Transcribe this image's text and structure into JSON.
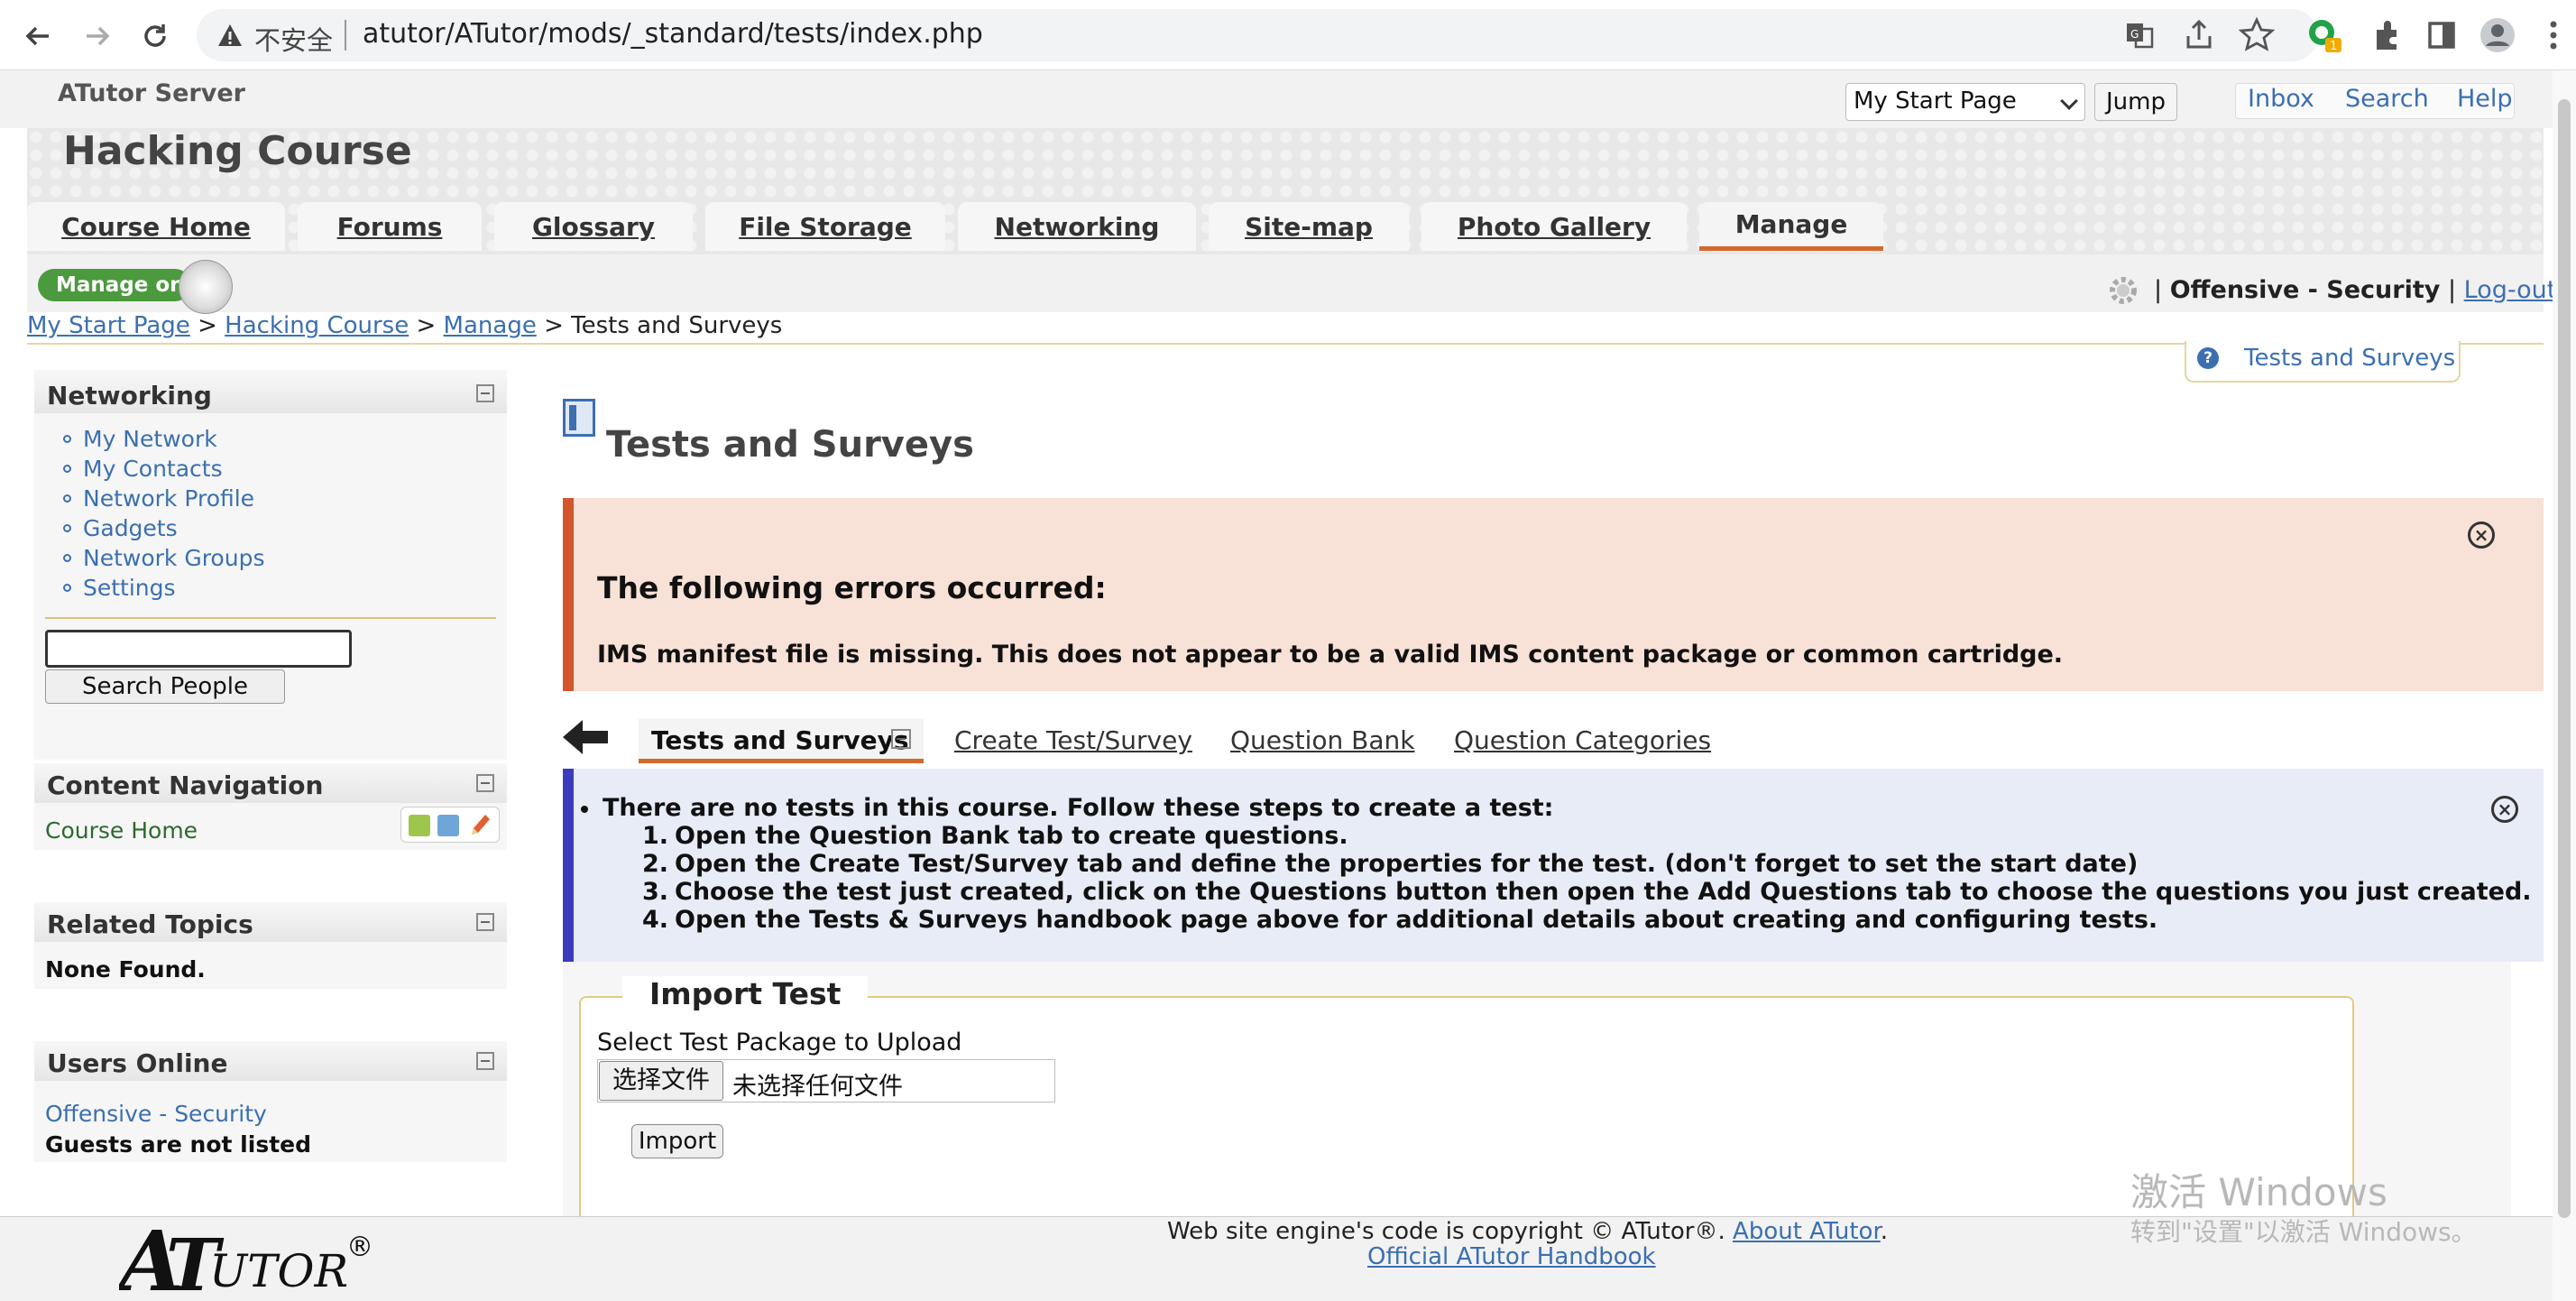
{
  "browser": {
    "insecure_label": "不安全",
    "url": "atutor/ATutor/mods/_standard/tests/index.php"
  },
  "top": {
    "site_name": "ATutor Server",
    "jump_select": "My Start Page",
    "jump_button": "Jump",
    "links": [
      "Inbox",
      "Search",
      "Help"
    ]
  },
  "course": {
    "title": "Hacking Course",
    "tabs": [
      "Course Home",
      "Forums",
      "Glossary",
      "File Storage",
      "Networking",
      "Site-map",
      "Photo Gallery",
      "Manage"
    ]
  },
  "manage": {
    "toggle_label": "Manage on",
    "user": "Offensive - Security",
    "logout": "Log-out"
  },
  "breadcrumb": {
    "items": [
      "My Start Page",
      "Hacking Course",
      "Manage"
    ],
    "current": "Tests and Surveys"
  },
  "help_tab": "Tests and Surveys",
  "sidebar": {
    "networking": {
      "title": "Networking",
      "items": [
        "My Network",
        "My Contacts",
        "Network Profile",
        "Gadgets",
        "Network Groups",
        "Settings"
      ],
      "search_button": "Search People"
    },
    "content_nav": {
      "title": "Content Navigation",
      "item": "Course Home"
    },
    "related": {
      "title": "Related Topics",
      "text": "None Found."
    },
    "users_online": {
      "title": "Users Online",
      "user": "Offensive - Security",
      "note": "Guests are not listed"
    }
  },
  "main": {
    "title": "Tests and Surveys",
    "error": {
      "title": "The following errors occurred:",
      "message": "IMS manifest file is missing. This does not appear to be a valid IMS content package or common cartridge."
    },
    "subtabs": [
      "Tests and Surveys",
      "Create Test/Survey",
      "Question Bank",
      "Question Categories"
    ],
    "info": {
      "lead": "There are no tests in this course. Follow these steps to create a test:",
      "steps": [
        "Open the Question Bank tab to create questions.",
        "Open the Create Test/Survey tab and define the properties for the test. (don't forget to set the start date)",
        "Choose the test just created, click on the Questions button then open the Add Questions tab to choose the questions you just created.",
        "Open the Tests & Surveys handbook page above for additional details about creating and configuring tests."
      ]
    },
    "import": {
      "legend": "Import Test",
      "label": "Select Test Package to Upload",
      "file_button": "选择文件",
      "file_status": "未选择任何文件",
      "submit": "Import"
    }
  },
  "footer": {
    "logo": "ATUTOR",
    "copyright": "Web site engine's code is copyright © ATutor®.",
    "about_link": "About ATutor",
    "handbook_link": "Official ATutor Handbook"
  },
  "watermark": {
    "line1": "激活 Windows",
    "line2": "转到\"设置\"以激活 Windows。"
  }
}
